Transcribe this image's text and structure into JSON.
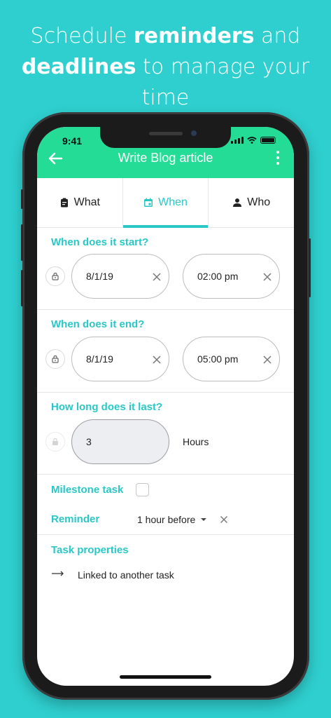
{
  "headline": {
    "line1_pre": "Schedule ",
    "line1_bold": "reminders",
    "line1_post": " and",
    "line2_bold": "deadlines",
    "line2_post": " to manage your time"
  },
  "status_bar": {
    "time": "9:41"
  },
  "app_bar": {
    "title": "Write Blog article"
  },
  "tabs": [
    {
      "label": "What",
      "icon": "clipboard-icon"
    },
    {
      "label": "When",
      "icon": "calendar-icon"
    },
    {
      "label": "Who",
      "icon": "person-icon"
    }
  ],
  "start": {
    "label": "When does it start?",
    "date": "8/1/19",
    "time": "02:00 pm"
  },
  "end": {
    "label": "When does it end?",
    "date": "8/1/19",
    "time": "05:00 pm"
  },
  "duration": {
    "label": "How long does it last?",
    "value": "3",
    "unit": "Hours"
  },
  "milestone": {
    "label": "Milestone task"
  },
  "reminder": {
    "label": "Reminder",
    "value": "1 hour before"
  },
  "task_properties": {
    "label": "Task properties",
    "link_text": "Linked to another task"
  },
  "colors": {
    "background": "#2fcfcf",
    "app_bar": "#25dc96",
    "accent": "#2ac7c7"
  }
}
